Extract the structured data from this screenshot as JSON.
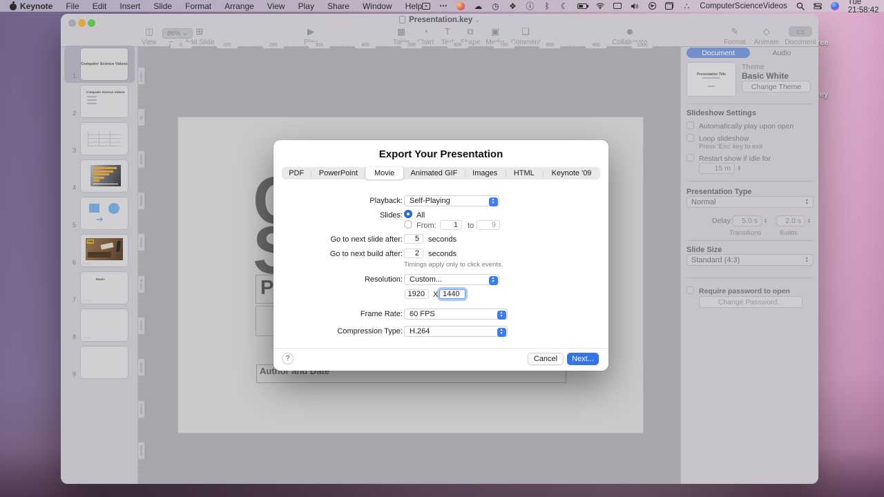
{
  "menu_bar": {
    "items": [
      "Keynote",
      "File",
      "Edit",
      "Insert",
      "Slide",
      "Format",
      "Arrange",
      "View",
      "Play",
      "Share",
      "Window",
      "Help"
    ],
    "app_icon_names": [
      "screen-mirroring-icon",
      "more-dots-icon",
      "colors-orb-icon"
    ],
    "status_icon_names": [
      "cloud-icon",
      "time-machine-icon",
      "photos-icon",
      "info-icon",
      "bluetooth-icon",
      "moon-icon",
      "battery-icon",
      "wifi-icon",
      "display-icon",
      "volume-icon",
      "play-circle-icon",
      "windows-icon",
      "dots-icon",
      "search-icon",
      "control-center-icon",
      "siri-orb-icon"
    ],
    "more_dots": "•••",
    "user_name": "ComputerScienceVideos",
    "clock": "Tue 21:58:42",
    "cloud_glyph": "☁",
    "clock_glyph": "◷",
    "photos_glyph": "❖",
    "info_glyph": "ⓘ",
    "bluetooth_glyph": "ᛒ",
    "moon_glyph": "☾",
    "play_glyph": "▶",
    "dots_glyph": "∴"
  },
  "window": {
    "title": "Presentation.key",
    "title_chevron": "⌄"
  },
  "toolbar": {
    "items": [
      {
        "label": "View",
        "icon": "◫"
      },
      {
        "label": "Zoom",
        "value": "86% ⌄"
      },
      {
        "label": "Add Slide",
        "icon": "⊞"
      },
      {
        "label": "Play",
        "icon": "▶"
      },
      {
        "label": "Table",
        "icon": "▦"
      },
      {
        "label": "Chart",
        "icon": "◔"
      },
      {
        "label": "Text",
        "icon": "T"
      },
      {
        "label": "Shape",
        "icon": "⧉"
      },
      {
        "label": "Media",
        "icon": "▣"
      },
      {
        "label": "Comment",
        "icon": "❑"
      },
      {
        "label": "Collaborate",
        "icon": "☻"
      },
      {
        "label": "Format",
        "icon": "✎"
      },
      {
        "label": "Animate",
        "icon": "◇"
      },
      {
        "label": "Document",
        "icon": "▭"
      }
    ]
  },
  "navigator": {
    "slides": [
      {
        "num": "1",
        "text": "Computer Science Videos"
      },
      {
        "num": "2",
        "text": "Computer Science Videos"
      },
      {
        "num": "3",
        "text": ""
      },
      {
        "num": "4",
        "text": ""
      },
      {
        "num": "5",
        "text": ""
      },
      {
        "num": "6",
        "text": ""
      },
      {
        "num": "7",
        "text": "Music"
      },
      {
        "num": "8",
        "text": ""
      },
      {
        "num": "9",
        "text": ""
      }
    ],
    "build_badge": "○○○"
  },
  "canvas": {
    "ruler_h": [
      "0",
      "100",
      "200",
      "300",
      "400",
      "500",
      "600",
      "700",
      "800",
      "900",
      "1000"
    ],
    "ruler_v": [
      "100",
      "0",
      "100",
      "200",
      "300",
      "400",
      "500",
      "600",
      "700",
      "800"
    ],
    "title_fragment_1": "C",
    "title_fragment_2": "S",
    "subtitle_fragment": "Pr",
    "author_box_text": "Author and Date"
  },
  "sidebar": {
    "tabs": {
      "document": "Document",
      "audio": "Audio"
    },
    "theme": {
      "label": "Theme",
      "name": "Basic White",
      "change_button": "Change Theme",
      "preview_title": "Presentation Title"
    },
    "slideshow": {
      "heading": "Slideshow Settings",
      "auto_play": "Automatically play upon open",
      "loop": "Loop slideshow",
      "loop_note": "Press 'Esc' key to exit",
      "restart": "Restart show if idle for",
      "idle_value": "15 m"
    },
    "presentation_type": {
      "heading": "Presentation Type",
      "value": "Normal",
      "delay_label": "Delay:",
      "transitions_value": "5.0 s",
      "transitions_label": "Transitions",
      "builds_value": "2.0 s",
      "builds_label": "Builds"
    },
    "slide_size": {
      "heading": "Slide Size",
      "value": "Standard (4:3)"
    },
    "password": {
      "checkbox": "Require password to open",
      "change_button": "Change Password..."
    }
  },
  "dialog": {
    "title": "Export Your Presentation",
    "tabs": [
      "PDF",
      "PowerPoint",
      "Movie",
      "Animated GIF",
      "Images",
      "HTML",
      "Keynote '09"
    ],
    "selected_tab": "Movie",
    "playback_label": "Playback:",
    "playback_value": "Self-Playing",
    "slides_label": "Slides:",
    "all_label": "All",
    "from_label": "From:",
    "from_value": "1",
    "to_label": "to",
    "to_value": "9",
    "next_slide_label": "Go to next slide after:",
    "next_slide_value": "5",
    "next_slide_unit": "seconds",
    "next_build_label": "Go to next build after:",
    "next_build_value": "2",
    "next_build_unit": "seconds",
    "timings_note": "Timings apply only to click events.",
    "resolution_label": "Resolution:",
    "resolution_value": "Custom...",
    "res_width": "1920",
    "res_x": "X",
    "res_height": "1440",
    "frame_rate_label": "Frame Rate:",
    "frame_rate_value": "60 FPS",
    "compression_label": "Compression Type:",
    "compression_value": "H.264",
    "help_label": "?",
    "cancel_label": "Cancel",
    "next_label": "Next...",
    "accent_color": "#3574e6"
  },
  "desktop": {
    "partial_labels": [
      "ree",
      "ey"
    ]
  }
}
